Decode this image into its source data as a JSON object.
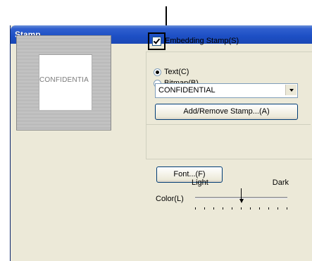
{
  "window": {
    "title": "Stamp"
  },
  "preview": {
    "stamp_text": "CONFIDENTIA"
  },
  "embedding": {
    "label": "Embedding Stamp",
    "hotkey": "(S)",
    "checked": true
  },
  "stamp_type": {
    "text_option": {
      "label": "Text",
      "hotkey": "(C)",
      "selected": true
    },
    "bitmap_option": {
      "label": "Bitmap",
      "hotkey": "(B)",
      "selected": false
    }
  },
  "stamp_select": {
    "value": "CONFIDENTIAL"
  },
  "buttons": {
    "add_remove": "Add/Remove Stamp...(A)",
    "font": "Font...(F)"
  },
  "color": {
    "label": "Color(L)",
    "light_label": "Light",
    "dark_label": "Dark",
    "level": 0.5,
    "tick_count": 11
  },
  "icons": {
    "checkbox": "check-icon",
    "dropdown": "chevron-down-icon"
  }
}
